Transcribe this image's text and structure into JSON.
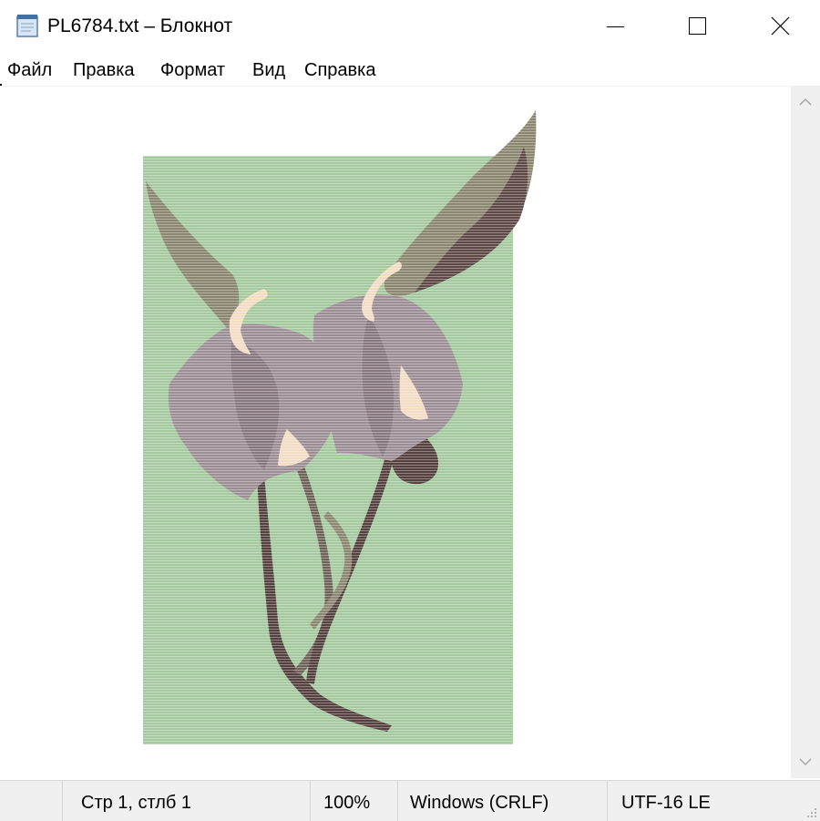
{
  "window": {
    "title": "PL6784.txt – Блокнот",
    "icons": {
      "app": "notepad-icon",
      "minimize": "minimize-icon",
      "maximize": "maximize-icon",
      "close": "close-icon"
    }
  },
  "menu": {
    "items": [
      {
        "label": "Файл"
      },
      {
        "label": "Правка"
      },
      {
        "label": "Формат"
      },
      {
        "label": "Вид"
      },
      {
        "label": "Справка"
      }
    ]
  },
  "document": {
    "content_description_icon": "flower-ascii-art",
    "colors": {
      "background_green": "#a4c99e",
      "petal_mauve": "#9c8e95",
      "leaf_olive": "#8b8670",
      "stem_dark": "#55413f",
      "cream": "#f2dcc4"
    }
  },
  "scrollbar": {
    "up_icon": "chevron-up-icon",
    "down_icon": "chevron-down-icon"
  },
  "status": {
    "position": "Стр 1, стлб 1",
    "zoom": "100%",
    "line_endings": "Windows (CRLF)",
    "encoding": "UTF-16 LE",
    "grip_icon": "resize-grip-icon"
  }
}
